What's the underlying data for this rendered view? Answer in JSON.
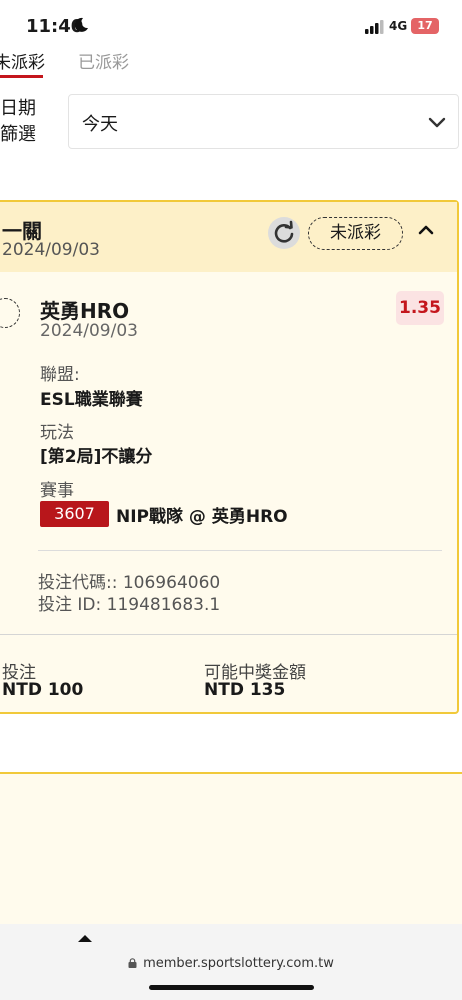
{
  "status_bar": {
    "time": "11:40",
    "network": "4G",
    "battery": "17"
  },
  "tabs": [
    {
      "label": "未派彩"
    },
    {
      "label": "已派彩"
    }
  ],
  "filter": {
    "label": "日期篩選",
    "value": "今天"
  },
  "bet": {
    "title": "一關",
    "date": "2024/09/03",
    "status": "未派彩",
    "selection": {
      "team": "英勇HRO",
      "date": "2024/09/03",
      "odds": "1.35",
      "league_label": "聯盟:",
      "league": "ESL職業聯賽",
      "play_label": "玩法",
      "play": "[第2局]不讓分",
      "event_label": "賽事",
      "event_no": "3607",
      "event_name": "NIP戰隊 @ 英勇HRO"
    },
    "bet_code": "投注代碼:: 106964060",
    "bet_id": "投注 ID: 119481683.1",
    "stake_label": "投注",
    "stake": "NTD 100",
    "payout_label": "可能中獎金額",
    "payout": "NTD 135"
  },
  "browser": {
    "url": "member.sportslottery.com.tw"
  },
  "colors": {
    "accent": "#c4161c",
    "card_border": "#f1c93a",
    "card_header": "#fdf0c8"
  }
}
